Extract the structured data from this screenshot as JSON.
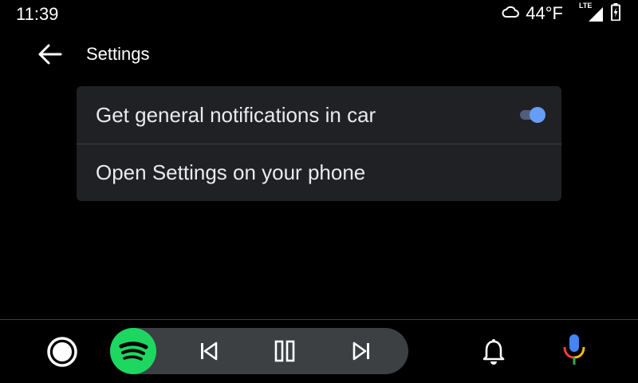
{
  "status_bar": {
    "time": "11:39",
    "temperature": "44°F",
    "weather_icon": "cloud-icon",
    "network_label": "LTE",
    "signal_icon": "signal-icon",
    "battery_icon": "battery-charging-icon"
  },
  "header": {
    "back_icon": "arrow-back-icon",
    "title": "Settings"
  },
  "settings": {
    "items": [
      {
        "label": "Get general notifications in car",
        "toggle_on": true
      },
      {
        "label": "Open Settings on your phone"
      }
    ]
  },
  "bottom_bar": {
    "home_icon": "home-circle-icon",
    "media_app_icon": "spotify-icon",
    "controls": [
      "skip-previous-icon",
      "pause-icon",
      "skip-next-icon"
    ],
    "notification_icon": "bell-icon",
    "assistant_icon": "microphone-icon"
  },
  "colors": {
    "background": "#000000",
    "card": "#202124",
    "divider": "#3c4043",
    "toggle_thumb": "#669df6",
    "toggle_track": "#4f5e7c",
    "spotify_green": "#1ed760",
    "media_pill": "#3c4043"
  }
}
